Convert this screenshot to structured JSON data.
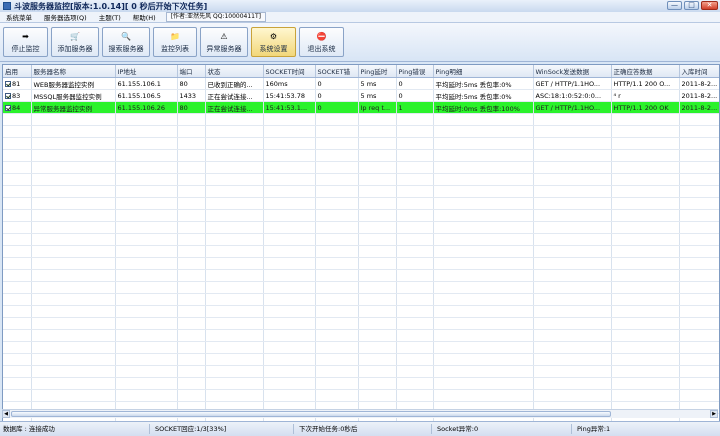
{
  "window": {
    "title": "斗波服务器监控[版本:1.0.14][ 0 秒后开始下次任务]",
    "min_glyph": "—",
    "max_glyph": "□",
    "close_glyph": "✕"
  },
  "menu": {
    "items": [
      "系统菜单",
      "服务器选项(Q)",
      "主题(T)",
      "帮助(H)"
    ],
    "info": "[作者:亚然先风 QQ:10000411T]"
  },
  "toolbar": {
    "buttons": [
      {
        "label": "停止监控",
        "icon": "pause-icon",
        "glyph": "➡"
      },
      {
        "label": "添加服务器",
        "icon": "cart-icon",
        "glyph": "🛒"
      },
      {
        "label": "搜索服务器",
        "icon": "search-icon",
        "glyph": "🔍"
      },
      {
        "label": "监控列表",
        "icon": "list-icon",
        "glyph": "📁"
      },
      {
        "label": "异常服务器",
        "icon": "warning-icon",
        "glyph": "⚠"
      },
      {
        "label": "系统设置",
        "icon": "gear-icon",
        "glyph": "⚙"
      },
      {
        "label": "退出系统",
        "icon": "exit-icon",
        "glyph": "⛔"
      }
    ],
    "active_index": 5
  },
  "table": {
    "columns": [
      "启用",
      "服务器名称",
      "IP地址",
      "端口",
      "状态",
      "SOCKET时间",
      "SOCKET错",
      "Ping延时",
      "Ping错误",
      "Ping明细",
      "WinSock发送数据",
      "正确应答数据",
      "入库时间"
    ],
    "rows": [
      {
        "id": "81",
        "name": "WEB服务器监控实例",
        "ip": "61.155.106.1",
        "port": "80",
        "status": "已收到正确的...",
        "socket_time": "160ms",
        "socket_err": "0",
        "ping_delay": "5 ms",
        "ping_err": "0",
        "ping_detail": "平均延时:5ms  丢包率:0%",
        "winsock": "GET / HTTP/1.1HO...",
        "reply": "HTTP/1.1 200 O...",
        "time": "2011-8-2..."
      },
      {
        "id": "83",
        "name": "MSSQL服务器监控实例",
        "ip": "61.155.106.5",
        "port": "1433",
        "status": "正在尝试连接...",
        "socket_time": "15:41:53.78",
        "socket_err": "0",
        "ping_delay": "5 ms",
        "ping_err": "0",
        "ping_detail": "平均延时:5ms  丢包率:0%",
        "winsock": "ASC:18:1:0:52:0:0...",
        "reply": "⁴ r",
        "time": "2011-8-2..."
      },
      {
        "id": "84",
        "name": "异常服务器监控实例",
        "ip": "61.155.106.26",
        "port": "80",
        "status": "正在尝试连接...",
        "socket_time": "15:41:53.1...",
        "socket_err": "0",
        "ping_delay": "Ip req t...",
        "ping_err": "1",
        "ping_detail": "平均延时:0ms  丢包率:100%",
        "winsock": "GET / HTTP/1.1HO...",
        "reply": "HTTP/1.1 200 OK",
        "time": "2011-8-2..."
      }
    ],
    "selected_row": 2
  },
  "status": {
    "db": "数据库 : 连接成功",
    "socket_progress": "SOCKET回应:1/3[33%]",
    "next_task": "下次开始任务:0秒后",
    "socket_errors": "Socket异常:0",
    "ping_errors": "Ping异常:1"
  },
  "colors": {
    "selected_row": "#2bf22b",
    "accent": "#3b6cb4"
  }
}
